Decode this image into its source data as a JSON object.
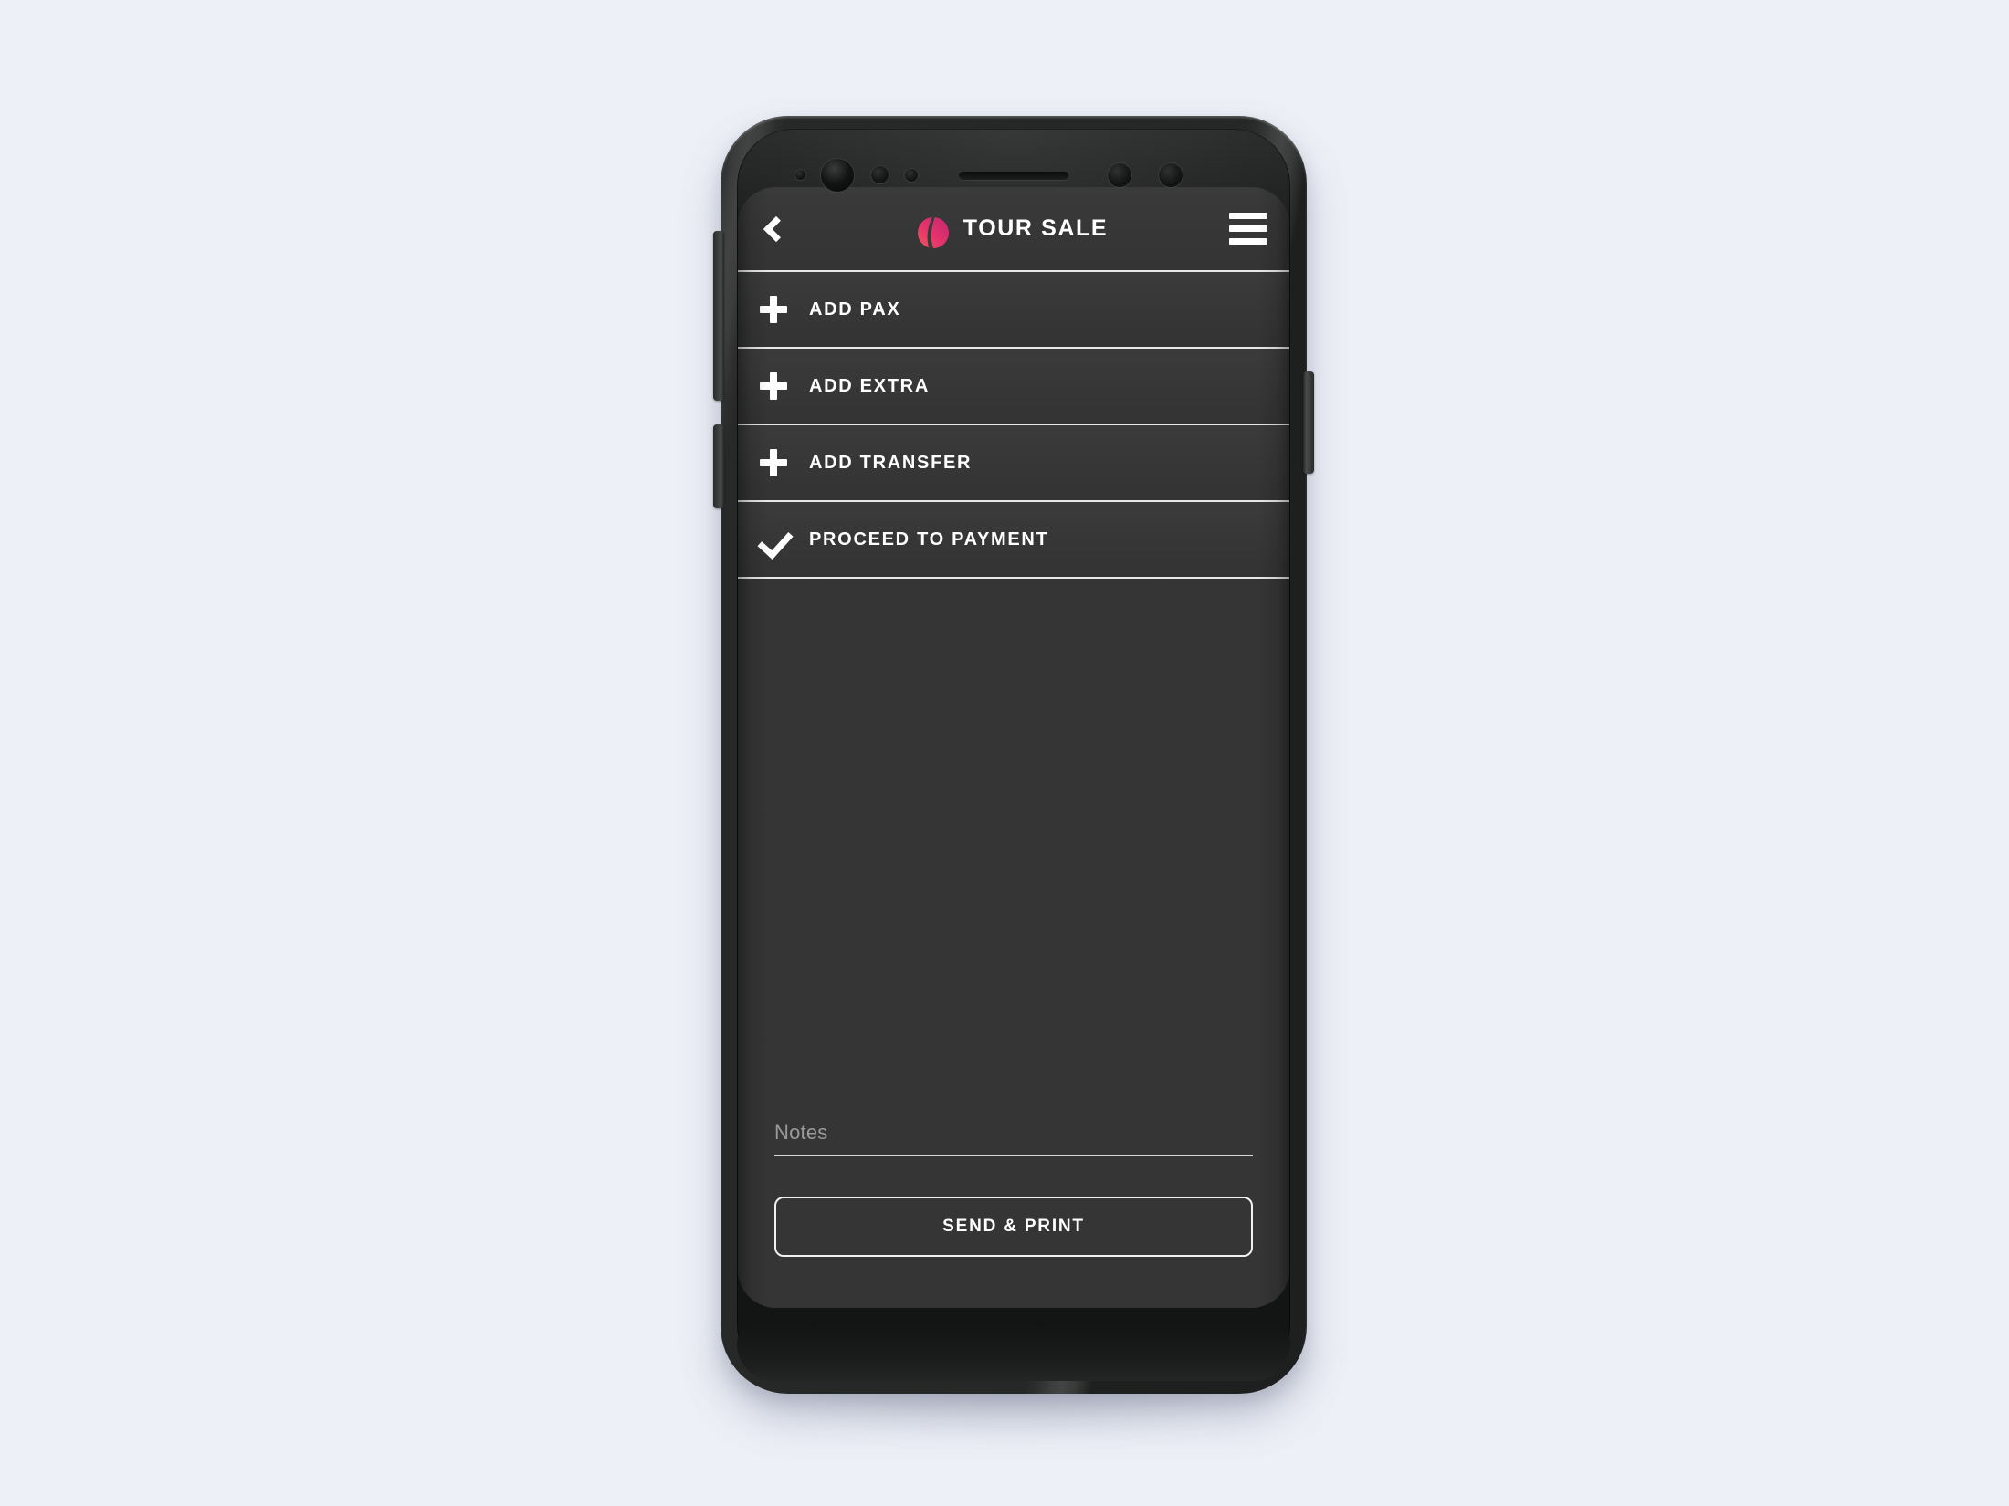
{
  "background_color": "#eef0f8",
  "device": {
    "name": "smartphone-mockup",
    "body_color": "#2b2c2c",
    "screen_background": "#353535",
    "hardware": {
      "front_camera": "camera-sensor",
      "earpiece": "earpiece-speaker",
      "volume_button": "volume-rocker",
      "bixby_button": "assistant-button",
      "power_button": "power-button"
    }
  },
  "app": {
    "accent_color": "#e4326d",
    "text_color": "#ffffff",
    "appbar": {
      "back_label": "Back",
      "logo_name": "tour-sale-logo",
      "title": "TOUR SALE",
      "menu_label": "Menu"
    },
    "actions": [
      {
        "id": "add-pax",
        "icon": "plus-icon",
        "label": "ADD PAX"
      },
      {
        "id": "add-extra",
        "icon": "plus-icon",
        "label": "ADD EXTRA"
      },
      {
        "id": "add-transfer",
        "icon": "plus-icon",
        "label": "ADD TRANSFER"
      },
      {
        "id": "proceed-to-payment",
        "icon": "check-icon",
        "label": "PROCEED TO PAYMENT"
      }
    ],
    "notes": {
      "label": "Notes",
      "placeholder": "Notes",
      "value": ""
    },
    "primary_button": {
      "label": "SEND & PRINT"
    }
  }
}
